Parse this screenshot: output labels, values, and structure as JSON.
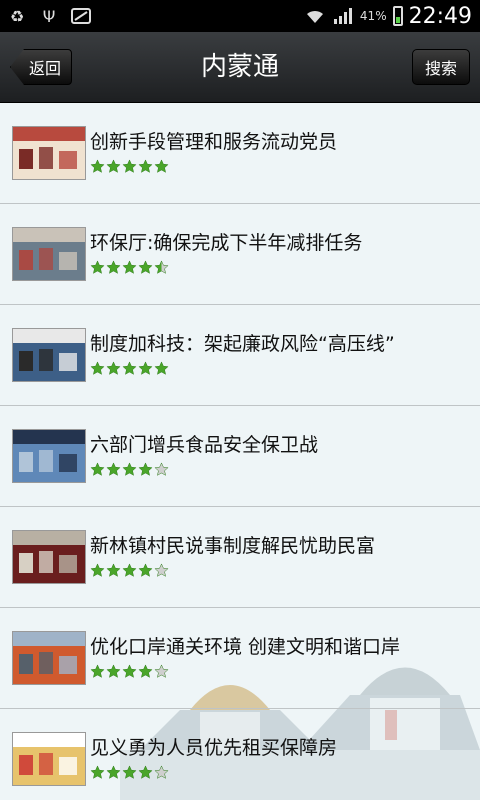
{
  "status_bar": {
    "battery_text": "41%",
    "time": "22:49",
    "icons": [
      "recycle-icon",
      "usb-icon",
      "notification-icon",
      "wifi-icon",
      "signal-icon",
      "battery-icon"
    ]
  },
  "header": {
    "title": "内蒙通",
    "back_label": "返回",
    "search_label": "搜索"
  },
  "colors": {
    "star_on": "#4aa52a",
    "star_off": "#cfcfcf",
    "header_bg": "#2a2c2f"
  },
  "items": [
    {
      "title": "创新手段管理和服务流动党员",
      "rating": 5
    },
    {
      "title": "环保厅:确保完成下半年减排任务",
      "rating": 4.5
    },
    {
      "title": "制度加科技：架起廉政风险“高压线”",
      "rating": 5
    },
    {
      "title": "六部门增兵食品安全保卫战",
      "rating": 4
    },
    {
      "title": "新林镇村民说事制度解民忧助民富",
      "rating": 4
    },
    {
      "title": "优化口岸通关环境 创建文明和谐口岸",
      "rating": 4
    },
    {
      "title": "见义勇为人员优先租买保障房",
      "rating": 4
    }
  ]
}
